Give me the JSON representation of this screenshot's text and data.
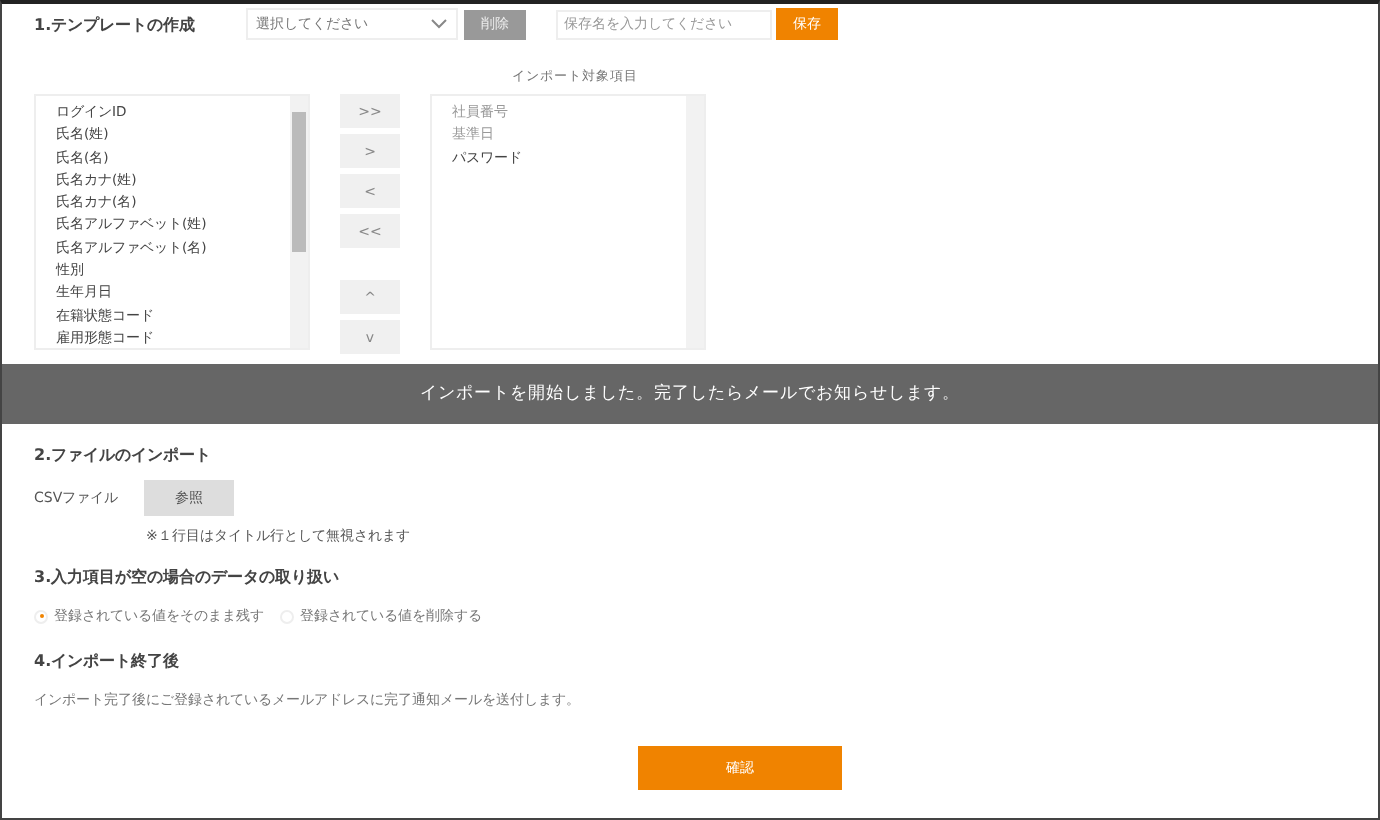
{
  "template": {
    "heading": "1.テンプレートの作成",
    "select": {
      "placeholder": "選択してください"
    },
    "delete_button": {
      "label": "削除",
      "disabled": true
    },
    "name_field": {
      "placeholder": "保存名を入力してください"
    },
    "save_button": "保存"
  },
  "target_label": "インポート対象項目",
  "available_items": [
    {
      "label": "ログインID"
    },
    {
      "label": "氏名(姓)"
    },
    {
      "label": "氏名(名)"
    },
    {
      "label": "氏名カナ(姓)"
    },
    {
      "label": "氏名カナ(名)"
    },
    {
      "label": "氏名アルファベット(姓)"
    },
    {
      "label": "氏名アルファベット(名)"
    },
    {
      "label": "性別"
    },
    {
      "label": "生年月日"
    },
    {
      "label": "在籍状態コード"
    },
    {
      "label": "雇用形態コード"
    }
  ],
  "transfer_buttons": [
    ">>",
    ">",
    "<",
    "<<"
  ],
  "order_buttons": [
    "^",
    "v"
  ],
  "selected_items": [
    {
      "label": "社員番号",
      "disabled": true
    },
    {
      "label": "基準日",
      "disabled": true
    },
    {
      "label": "パスワード",
      "disabled": false
    }
  ],
  "toast": "インポートを開始しました。完了したらメールでお知らせします。",
  "file_import": {
    "heading": "2.ファイルのインポート",
    "label": "CSVファイル",
    "browse_button": "参照",
    "note": "※１行目はタイトル行として無視されます"
  },
  "empty_handling": {
    "heading": "3.入力項目が空の場合のデータの取り扱い",
    "options": [
      {
        "label": "登録されている値をそのまま残す",
        "selected": true
      },
      {
        "label": "登録されている値を削除する",
        "selected": false
      }
    ]
  },
  "after_import": {
    "heading": "4.インポート終了後",
    "text": "インポート完了後にご登録されているメールアドレスに完了通知メールを送付します。"
  },
  "confirm_button": "確認"
}
